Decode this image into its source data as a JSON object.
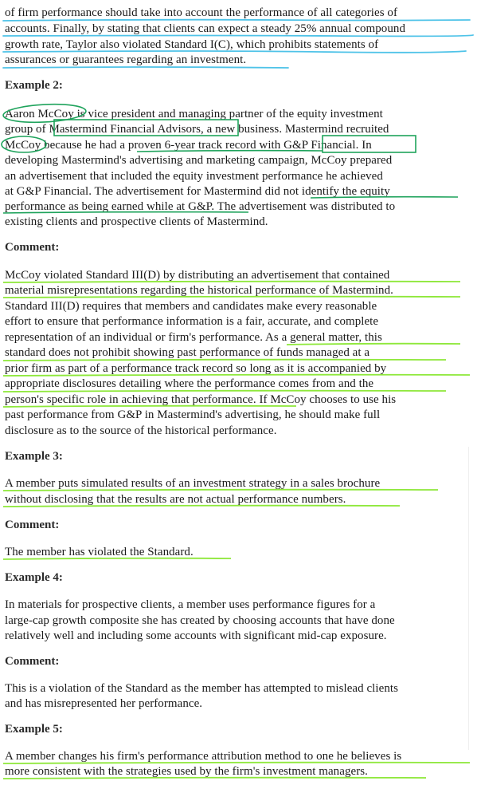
{
  "intro": {
    "lines": [
      "of firm performance should take into account the performance of all categories of",
      "accounts. Finally, by stating that clients can expect a steady 25% annual compound",
      "growth rate, Taylor also violated Standard I(C), which prohibits statements of",
      "assurances or guarantees regarding an investment."
    ]
  },
  "example2": {
    "heading": "Example 2:",
    "lines": [
      "Aaron McCoy is vice president and managing partner of the equity investment",
      "group of Mastermind Financial Advisors, a new business. Mastermind recruited",
      "McCoy because he had a proven 6-year track record with G&P Financial. In",
      "developing Mastermind's advertising and marketing campaign, McCoy prepared",
      "an advertisement that included the equity investment performance he achieved",
      "at G&P Financial. The advertisement for Mastermind did not identify the equity",
      "performance as being earned while at G&P. The advertisement was distributed to",
      "existing clients and prospective clients of Mastermind."
    ]
  },
  "comment2": {
    "heading": "Comment:",
    "lines": [
      "McCoy violated Standard III(D) by distributing an advertisement that contained",
      "material misrepresentations regarding the historical performance of Mastermind.",
      "Standard III(D) requires that members and candidates make every reasonable",
      "effort to ensure that performance information is a fair, accurate, and complete",
      "representation of an individual or firm's performance. As a general matter, this",
      "standard does not prohibit showing past performance of funds managed at a",
      "prior firm as part of a performance track record so long as it is accompanied by",
      "appropriate disclosures detailing where the performance comes from and the",
      "person's specific role in achieving that performance. If McCoy chooses to use his",
      "past performance from G&P in Mastermind's advertising, he should make full",
      "disclosure as to the source of the historical performance."
    ]
  },
  "example3": {
    "heading": "Example 3:",
    "lines": [
      "A member puts simulated results of an investment strategy in a sales brochure",
      "without disclosing that the results are not actual performance numbers."
    ]
  },
  "comment3": {
    "heading": "Comment:",
    "lines": [
      "The member has violated the Standard."
    ]
  },
  "example4": {
    "heading": "Example 4:",
    "lines": [
      "In materials for prospective clients, a member uses performance figures for a",
      "large-cap growth composite she has created by choosing accounts that have done",
      "relatively well and including some accounts with significant mid-cap exposure."
    ]
  },
  "comment4": {
    "heading": "Comment:",
    "lines": [
      "This is a violation of the Standard as the member has attempted to mislead clients",
      "and has misrepresented her performance."
    ]
  },
  "example5": {
    "heading": "Example 5:",
    "lines": [
      "A member changes his firm's performance attribution method to one he believes is",
      "more consistent with the strategies used by the firm's investment managers."
    ]
  },
  "annotation_colors": {
    "blue": "#4fc3e8",
    "lime": "#8ee83a",
    "green": "#1fa35c"
  }
}
